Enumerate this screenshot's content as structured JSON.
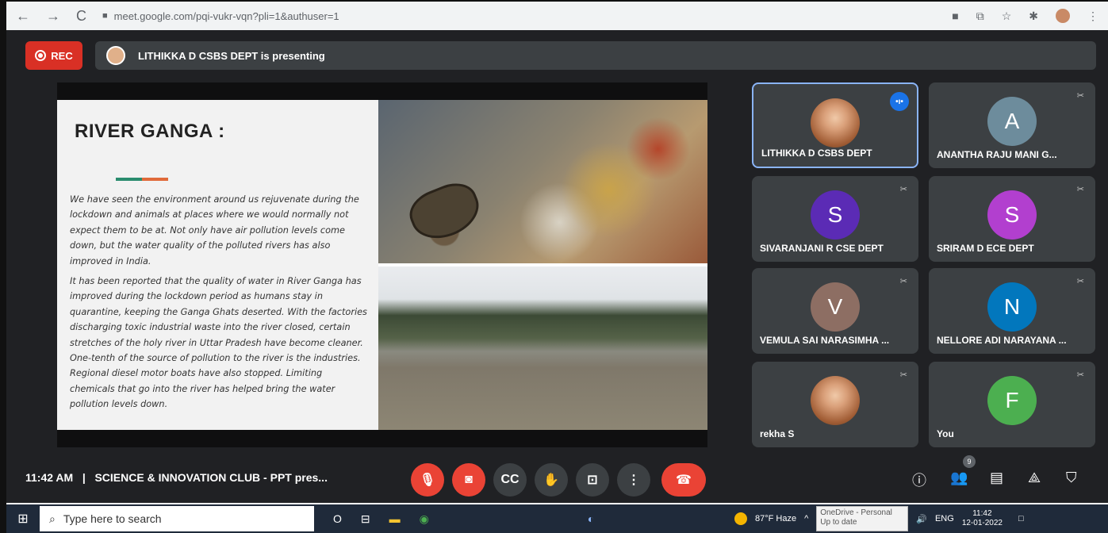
{
  "browser": {
    "url": "meet.google.com/pqi-vukr-vqn?pli=1&authuser=1",
    "nav_icons": [
      "←",
      "→",
      "C"
    ],
    "icons": [
      "■",
      "⧉",
      "☆",
      "✱"
    ]
  },
  "meet": {
    "rec_label": "REC",
    "presenting_text": "LITHIKKA D CSBS DEPT is presenting",
    "slide": {
      "title": "RIVER GANGA :",
      "paragraph1": "We have seen the environment around us rejuvenate during the lockdown and animals at places where we would normally not expect them to be at. Not only have air pollution levels come down, but the water quality of the polluted rivers has also improved in India.",
      "paragraph2": "It has been reported that the quality of water in River Ganga has improved during the lockdown period as humans stay in quarantine, keeping the Ganga Ghats deserted. With the factories discharging toxic industrial waste into the river closed, certain stretches of the holy river in Uttar Pradesh have become cleaner. One-tenth of the source of pollution to the river is the industries. Regional diesel motor boats have also stopped. Limiting chemicals that go into the river has helped bring the water pollution levels down."
    },
    "participants": [
      {
        "name": "LITHIKKA D CSBS DEPT",
        "initial": "",
        "color": "",
        "photo": true,
        "speaking": true
      },
      {
        "name": "ANANTHA RAJU MANI G...",
        "initial": "A",
        "color": "#6d8c9c",
        "photo": false
      },
      {
        "name": "SIVARANJANI R CSE DEPT",
        "initial": "S",
        "color": "#5b2bb5",
        "photo": false
      },
      {
        "name": "SRIRAM D ECE DEPT",
        "initial": "S",
        "color": "#b23fcf",
        "photo": false
      },
      {
        "name": "VEMULA SAI NARASIMHA ...",
        "initial": "V",
        "color": "#8d6e63",
        "photo": false
      },
      {
        "name": "NELLORE ADI NARAYANA ...",
        "initial": "N",
        "color": "#0277bd",
        "photo": false
      },
      {
        "name": "rekha S",
        "initial": "",
        "color": "",
        "photo": true
      },
      {
        "name": "You",
        "initial": "F",
        "color": "#4caf50",
        "photo": false
      }
    ],
    "mute_icon": "✂",
    "speaking_icon": "•ı•",
    "bottom": {
      "time": "11:42 AM",
      "meeting_name": "SCIENCE & INNOVATION CLUB - PPT pres...",
      "participant_badge": "9",
      "controls": [
        {
          "name": "mic-off-button",
          "icon": "mic-off-icon",
          "glyph": "🎙",
          "red": true
        },
        {
          "name": "camera-off-button",
          "icon": "camera-off-icon",
          "glyph": "◙",
          "red": true
        },
        {
          "name": "captions-button",
          "icon": "captions-icon",
          "glyph": "CC",
          "red": false
        },
        {
          "name": "raise-hand-button",
          "icon": "hand-icon",
          "glyph": "✋",
          "red": false
        },
        {
          "name": "present-button",
          "icon": "present-icon",
          "glyph": "⊡",
          "red": false
        },
        {
          "name": "more-options-button",
          "icon": "more-vert-icon",
          "glyph": "⋮",
          "red": false
        }
      ],
      "end_glyph": "☎",
      "right_icons": [
        {
          "name": "info-button",
          "icon": "info-icon",
          "glyph": "ⓘ"
        },
        {
          "name": "people-button",
          "icon": "people-icon",
          "glyph": "👥"
        },
        {
          "name": "chat-button",
          "icon": "chat-icon",
          "glyph": "▤"
        },
        {
          "name": "activities-button",
          "icon": "activities-icon",
          "glyph": "⟁"
        },
        {
          "name": "host-controls-button",
          "icon": "shield-icon",
          "glyph": "⛉"
        }
      ]
    }
  },
  "taskbar": {
    "start_glyph": "⊞",
    "search_glyph": "⌕",
    "search_placeholder": "Type here to search",
    "task_glyphs": [
      "O",
      "⊟",
      "▬",
      "◉",
      "◐"
    ],
    "weather": "87°F Haze",
    "onedrive_line1": "OneDrive - Personal",
    "onedrive_line2": "Up to date",
    "lang": "ENG",
    "time": "11:42",
    "date": "12-01-2022"
  },
  "colors": {
    "meet_bg": "#202124",
    "tile_bg": "#3c4043",
    "red": "#ea4335",
    "active_border": "#8ab4f8"
  }
}
